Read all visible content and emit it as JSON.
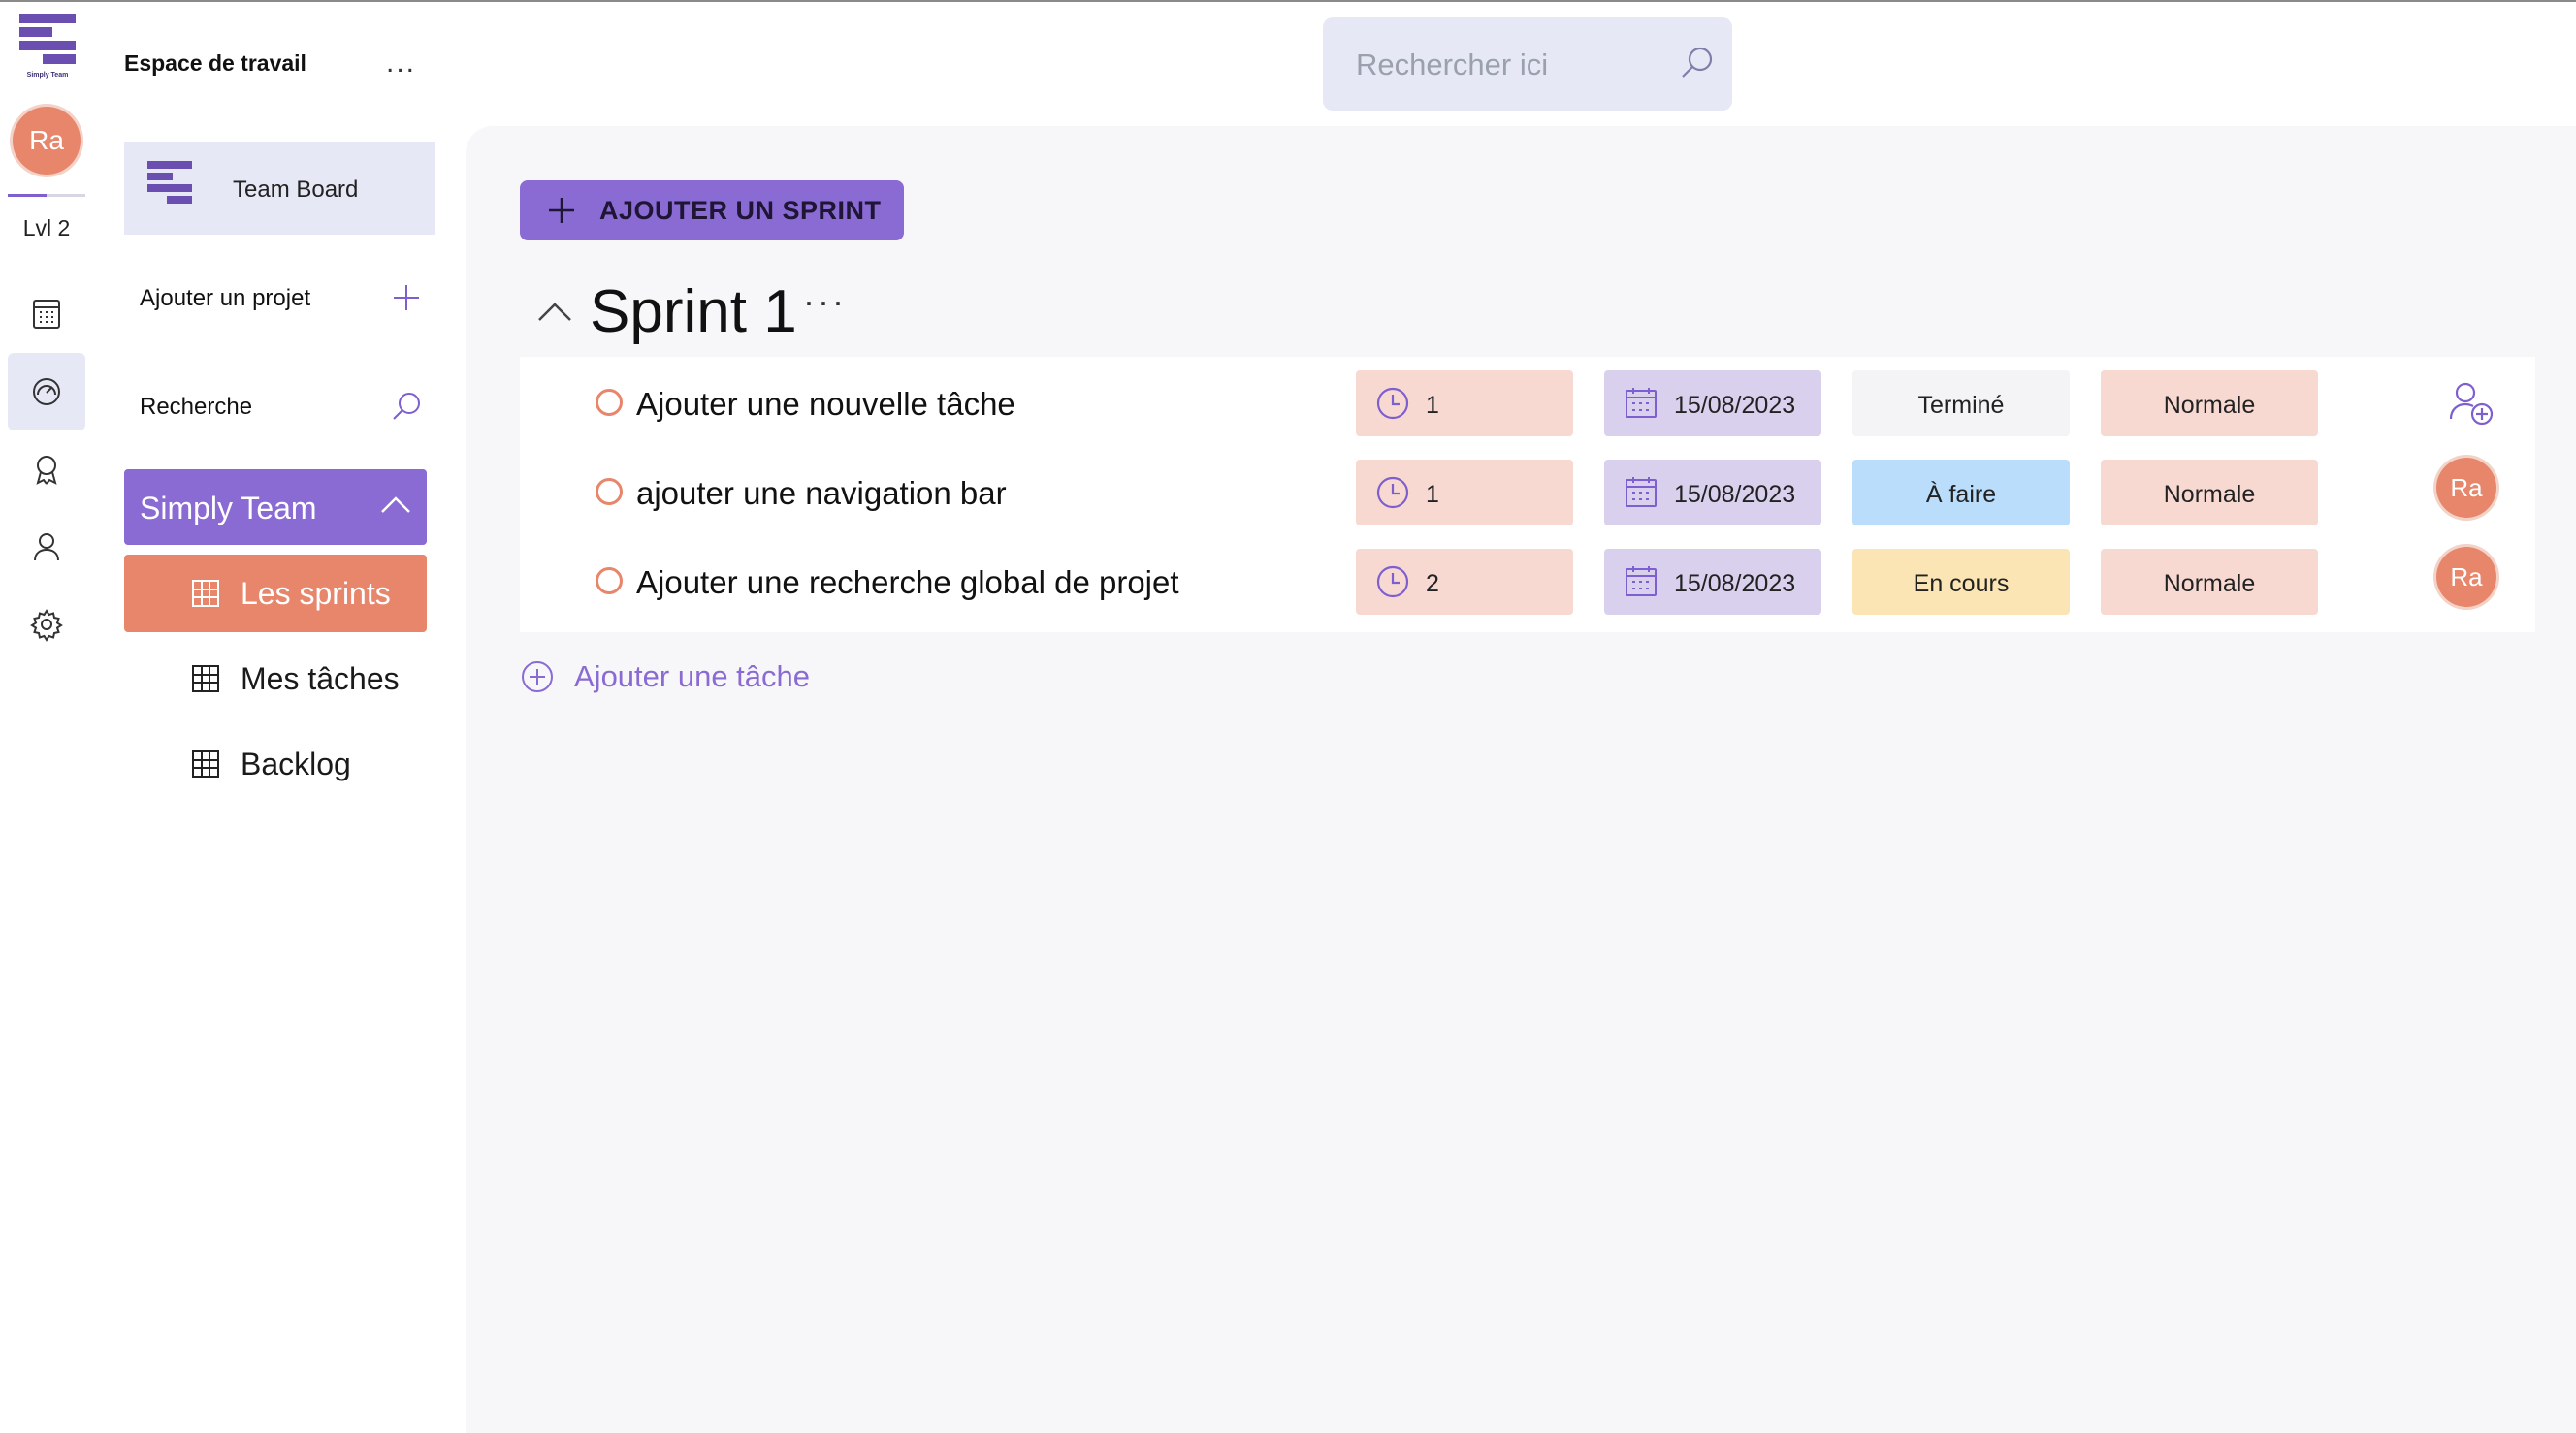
{
  "rail": {
    "logo_text": "Simply Team",
    "avatar_initials": "Ra",
    "level_label": "Lvl 2",
    "items": [
      "calendar-icon",
      "dashboard-icon",
      "badge-icon",
      "user-icon",
      "settings-icon"
    ]
  },
  "sidebar": {
    "workspace_title": "Espace de travail",
    "workspace_menu": "...",
    "board_label": "Team Board",
    "add_project_label": "Ajouter un projet",
    "search_label": "Recherche",
    "project_name": "Simply Team",
    "nav": [
      {
        "label": "Les sprints",
        "active": true
      },
      {
        "label": "Mes tâches",
        "active": false
      },
      {
        "label": "Backlog",
        "active": false
      }
    ]
  },
  "search": {
    "placeholder": "Rechercher ici"
  },
  "main": {
    "add_sprint_label": "AJOUTER UN SPRINT",
    "sprint_title": "Sprint 1",
    "sprint_menu": "···",
    "add_task_label": "Ajouter une tâche",
    "tasks": [
      {
        "name": "Ajouter une nouvelle tâche",
        "estimate": "1",
        "date": "15/08/2023",
        "status": "Terminé",
        "status_color": "#f4f4f6",
        "priority": "Normale",
        "assignee": ""
      },
      {
        "name": "ajouter une navigation bar",
        "estimate": "1",
        "date": "15/08/2023",
        "status": "À faire",
        "status_color": "#b9ddfa",
        "priority": "Normale",
        "assignee": "Ra"
      },
      {
        "name": "Ajouter une recherche global de projet",
        "estimate": "2",
        "date": "15/08/2023",
        "status": "En cours",
        "status_color": "#fbe5b4",
        "priority": "Normale",
        "assignee": "Ra"
      }
    ]
  },
  "colors": {
    "accent": "#8a6ad3",
    "avatar": "#e8866c",
    "estimate_bg": "#f7d9d2",
    "date_bg": "#d9d0ee",
    "priority_bg": "#f7d9d2"
  }
}
